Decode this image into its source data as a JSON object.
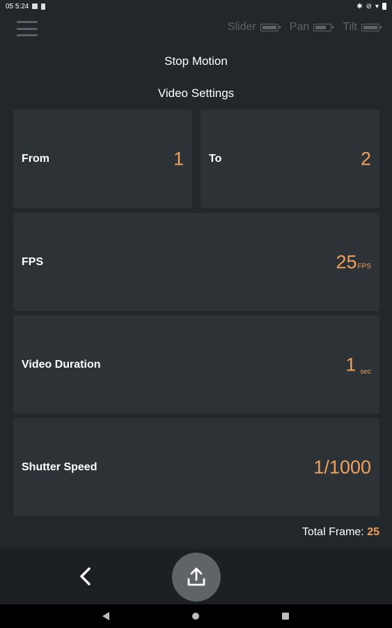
{
  "status_bar": {
    "time": "05 5:24"
  },
  "header": {
    "devices": [
      {
        "name": "Slider",
        "battery_level": 0.9
      },
      {
        "name": "Pan",
        "battery_level": 0.7
      },
      {
        "name": "Tilt",
        "battery_level": 0.9
      }
    ]
  },
  "mode_title": "Stop Motion",
  "section_title": "Video Settings",
  "settings": {
    "from": {
      "label": "From",
      "value": "1"
    },
    "to": {
      "label": "To",
      "value": "2"
    },
    "fps": {
      "label": "FPS",
      "value": "25",
      "unit": "FPS"
    },
    "video_duration": {
      "label": "Video Duration",
      "value": "1",
      "unit": "sec"
    },
    "shutter_speed": {
      "label": "Shutter Speed",
      "value": "1/1000"
    }
  },
  "total_frame": {
    "label": "Total Frame:",
    "value": "25"
  },
  "colors": {
    "background": "#22272b",
    "card": "#2d3237",
    "accent": "#f0a25c",
    "muted": "#5d6468"
  },
  "icons": {
    "menu": "hamburger-icon",
    "back": "chevron-left-icon",
    "upload": "upload-icon"
  }
}
